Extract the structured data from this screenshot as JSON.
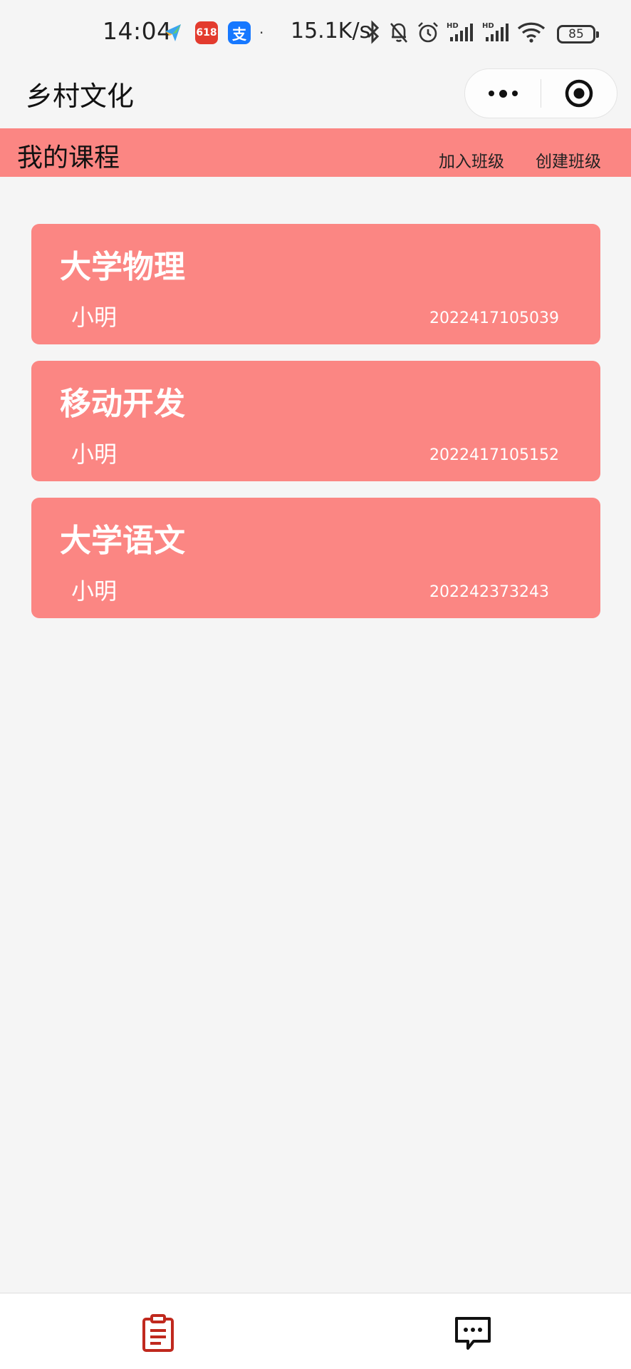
{
  "status_bar": {
    "time": "14:04",
    "network_speed": "15.1K/s",
    "battery": "85",
    "notification_icons": [
      "feishu-icon",
      "jd-618-icon",
      "alipay-icon"
    ]
  },
  "nav": {
    "title": "乡村文化"
  },
  "header": {
    "title": "我的课程",
    "join_class": "加入班级",
    "create_class": "创建班级"
  },
  "courses": [
    {
      "name": "大学物理",
      "teacher": "小明",
      "code": "2022417105039"
    },
    {
      "name": "移动开发",
      "teacher": "小明",
      "code": "2022417105152"
    },
    {
      "name": "大学语文",
      "teacher": "小明",
      "code": "202242373243"
    }
  ],
  "tabbar": {
    "tabs": [
      {
        "icon": "clipboard-icon",
        "active": true,
        "color": "#c0291e"
      },
      {
        "icon": "message-icon",
        "active": false,
        "color": "#111111"
      }
    ]
  },
  "colors": {
    "accent": "#fb8683",
    "background": "#f5f5f5",
    "active_tab": "#c0291e"
  }
}
